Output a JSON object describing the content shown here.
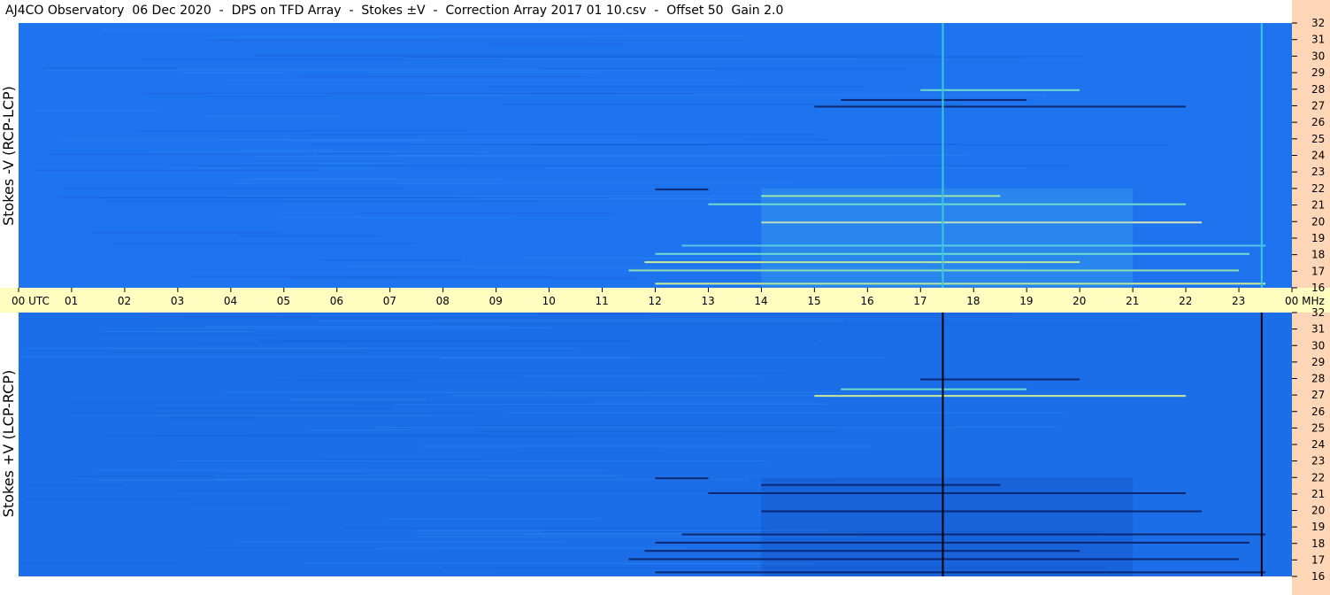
{
  "title": "AJ4CO Observatory  06 Dec 2020  -  DPS on TFD Array  -  Stokes ±V  -  Correction Array 2017 01 10.csv  -  Offset 50  Gain 2.0",
  "chart_data": [
    {
      "type": "heatmap",
      "panel": "top",
      "ylabel": "Stokes -V (RCP-LCP)",
      "x_unit": "UTC",
      "y_unit": "MHz",
      "xlim": [
        0,
        24
      ],
      "ylim": [
        16,
        32
      ],
      "x_ticks": [
        "00",
        "01",
        "02",
        "03",
        "04",
        "05",
        "06",
        "07",
        "08",
        "09",
        "10",
        "11",
        "12",
        "13",
        "14",
        "15",
        "16",
        "17",
        "18",
        "19",
        "20",
        "21",
        "22",
        "23",
        "00"
      ],
      "y_ticks": [
        "16",
        "17",
        "18",
        "19",
        "20",
        "21",
        "22",
        "23",
        "24",
        "25",
        "26",
        "27",
        "28",
        "29",
        "30",
        "31",
        "32"
      ],
      "colors": {
        "background": "#1e74ee",
        "hot": "#7df0c6",
        "cold": "#0b1b5a",
        "marker": "#39c9d8"
      },
      "vertical_markers_utc": [
        17.42,
        23.43
      ],
      "marker_color": "#39c9d8"
    },
    {
      "type": "heatmap",
      "panel": "bottom",
      "ylabel": "Stokes +V (LCP-RCP)",
      "x_unit": "UTC",
      "y_unit": "MHz",
      "xlim": [
        0,
        24
      ],
      "ylim": [
        16,
        32
      ],
      "x_ticks": [
        "00",
        "01",
        "02",
        "03",
        "04",
        "05",
        "06",
        "07",
        "08",
        "09",
        "10",
        "11",
        "12",
        "13",
        "14",
        "15",
        "16",
        "17",
        "18",
        "19",
        "20",
        "21",
        "22",
        "23",
        "00"
      ],
      "y_ticks": [
        "16",
        "17",
        "18",
        "19",
        "20",
        "21",
        "22",
        "23",
        "24",
        "25",
        "26",
        "27",
        "28",
        "29",
        "30",
        "31",
        "32"
      ],
      "colors": {
        "background": "#1b6ee8",
        "hot": "#7df0c6",
        "cold": "#0b1b5a",
        "marker": "#000000"
      },
      "vertical_markers_utc": [
        17.42,
        23.43
      ],
      "marker_color": "#000000"
    }
  ],
  "time_axis": {
    "labels": [
      "00  UTC",
      "01",
      "02",
      "03",
      "04",
      "05",
      "06",
      "07",
      "08",
      "09",
      "10",
      "11",
      "12",
      "13",
      "14",
      "15",
      "16",
      "17",
      "18",
      "19",
      "20",
      "21",
      "22",
      "23",
      "00  MHz"
    ]
  },
  "colors": {
    "time_axis_bg": "#fffdc0",
    "freq_axis_bg": "#fcd6b6"
  }
}
